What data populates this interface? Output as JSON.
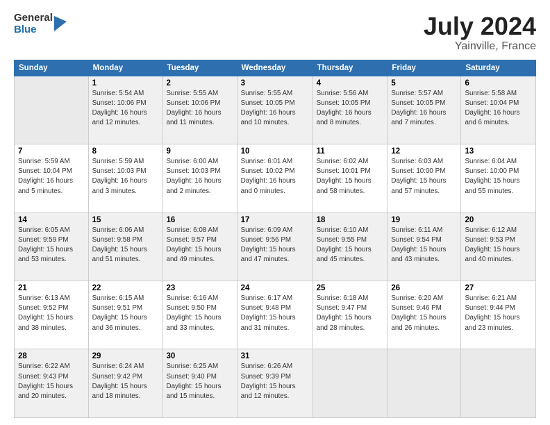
{
  "header": {
    "logo": {
      "general": "General",
      "blue": "Blue"
    },
    "title": "July 2024",
    "location": "Yainville, France"
  },
  "weekdays": [
    "Sunday",
    "Monday",
    "Tuesday",
    "Wednesday",
    "Thursday",
    "Friday",
    "Saturday"
  ],
  "weeks": [
    [
      {
        "day": "",
        "info": ""
      },
      {
        "day": "1",
        "info": "Sunrise: 5:54 AM\nSunset: 10:06 PM\nDaylight: 16 hours\nand 12 minutes."
      },
      {
        "day": "2",
        "info": "Sunrise: 5:55 AM\nSunset: 10:06 PM\nDaylight: 16 hours\nand 11 minutes."
      },
      {
        "day": "3",
        "info": "Sunrise: 5:55 AM\nSunset: 10:05 PM\nDaylight: 16 hours\nand 10 minutes."
      },
      {
        "day": "4",
        "info": "Sunrise: 5:56 AM\nSunset: 10:05 PM\nDaylight: 16 hours\nand 8 minutes."
      },
      {
        "day": "5",
        "info": "Sunrise: 5:57 AM\nSunset: 10:05 PM\nDaylight: 16 hours\nand 7 minutes."
      },
      {
        "day": "6",
        "info": "Sunrise: 5:58 AM\nSunset: 10:04 PM\nDaylight: 16 hours\nand 6 minutes."
      }
    ],
    [
      {
        "day": "7",
        "info": "Sunrise: 5:59 AM\nSunset: 10:04 PM\nDaylight: 16 hours\nand 5 minutes."
      },
      {
        "day": "8",
        "info": "Sunrise: 5:59 AM\nSunset: 10:03 PM\nDaylight: 16 hours\nand 3 minutes."
      },
      {
        "day": "9",
        "info": "Sunrise: 6:00 AM\nSunset: 10:03 PM\nDaylight: 16 hours\nand 2 minutes."
      },
      {
        "day": "10",
        "info": "Sunrise: 6:01 AM\nSunset: 10:02 PM\nDaylight: 16 hours\nand 0 minutes."
      },
      {
        "day": "11",
        "info": "Sunrise: 6:02 AM\nSunset: 10:01 PM\nDaylight: 15 hours\nand 58 minutes."
      },
      {
        "day": "12",
        "info": "Sunrise: 6:03 AM\nSunset: 10:00 PM\nDaylight: 15 hours\nand 57 minutes."
      },
      {
        "day": "13",
        "info": "Sunrise: 6:04 AM\nSunset: 10:00 PM\nDaylight: 15 hours\nand 55 minutes."
      }
    ],
    [
      {
        "day": "14",
        "info": "Sunrise: 6:05 AM\nSunset: 9:59 PM\nDaylight: 15 hours\nand 53 minutes."
      },
      {
        "day": "15",
        "info": "Sunrise: 6:06 AM\nSunset: 9:58 PM\nDaylight: 15 hours\nand 51 minutes."
      },
      {
        "day": "16",
        "info": "Sunrise: 6:08 AM\nSunset: 9:57 PM\nDaylight: 15 hours\nand 49 minutes."
      },
      {
        "day": "17",
        "info": "Sunrise: 6:09 AM\nSunset: 9:56 PM\nDaylight: 15 hours\nand 47 minutes."
      },
      {
        "day": "18",
        "info": "Sunrise: 6:10 AM\nSunset: 9:55 PM\nDaylight: 15 hours\nand 45 minutes."
      },
      {
        "day": "19",
        "info": "Sunrise: 6:11 AM\nSunset: 9:54 PM\nDaylight: 15 hours\nand 43 minutes."
      },
      {
        "day": "20",
        "info": "Sunrise: 6:12 AM\nSunset: 9:53 PM\nDaylight: 15 hours\nand 40 minutes."
      }
    ],
    [
      {
        "day": "21",
        "info": "Sunrise: 6:13 AM\nSunset: 9:52 PM\nDaylight: 15 hours\nand 38 minutes."
      },
      {
        "day": "22",
        "info": "Sunrise: 6:15 AM\nSunset: 9:51 PM\nDaylight: 15 hours\nand 36 minutes."
      },
      {
        "day": "23",
        "info": "Sunrise: 6:16 AM\nSunset: 9:50 PM\nDaylight: 15 hours\nand 33 minutes."
      },
      {
        "day": "24",
        "info": "Sunrise: 6:17 AM\nSunset: 9:48 PM\nDaylight: 15 hours\nand 31 minutes."
      },
      {
        "day": "25",
        "info": "Sunrise: 6:18 AM\nSunset: 9:47 PM\nDaylight: 15 hours\nand 28 minutes."
      },
      {
        "day": "26",
        "info": "Sunrise: 6:20 AM\nSunset: 9:46 PM\nDaylight: 15 hours\nand 26 minutes."
      },
      {
        "day": "27",
        "info": "Sunrise: 6:21 AM\nSunset: 9:44 PM\nDaylight: 15 hours\nand 23 minutes."
      }
    ],
    [
      {
        "day": "28",
        "info": "Sunrise: 6:22 AM\nSunset: 9:43 PM\nDaylight: 15 hours\nand 20 minutes."
      },
      {
        "day": "29",
        "info": "Sunrise: 6:24 AM\nSunset: 9:42 PM\nDaylight: 15 hours\nand 18 minutes."
      },
      {
        "day": "30",
        "info": "Sunrise: 6:25 AM\nSunset: 9:40 PM\nDaylight: 15 hours\nand 15 minutes."
      },
      {
        "day": "31",
        "info": "Sunrise: 6:26 AM\nSunset: 9:39 PM\nDaylight: 15 hours\nand 12 minutes."
      },
      {
        "day": "",
        "info": ""
      },
      {
        "day": "",
        "info": ""
      },
      {
        "day": "",
        "info": ""
      }
    ]
  ]
}
